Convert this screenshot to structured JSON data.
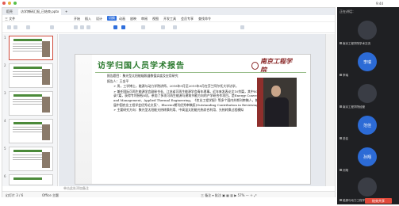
{
  "system_bar": {
    "left": "◉ ◉ ◉",
    "time": "9:44",
    "icons": "▢ ▣ ✕"
  },
  "tabs": [
    "稻壳",
    "访学博研汇报_已结束.pptx",
    "+"
  ],
  "menu": [
    "三 文件",
    "开始",
    "插入",
    "设计",
    "切换",
    "动画",
    "放映",
    "审阅",
    "视图",
    "开发工具",
    "会员专享",
    "查找命令"
  ],
  "menu_active_index": 4,
  "slide_numbers": [
    "1",
    "2",
    "3",
    "4",
    "5",
    "6"
  ],
  "slide": {
    "title": "访学归国人员学术报告",
    "logo": "南京工程学院",
    "report_title": "报告题目：聚光型太阳能辐照器数值实度及应用研究",
    "reporter": "报告人：王金平",
    "bullets": [
      "男，工学博士，能源与动力学院讲师。2018年9月至2019年8月在芬兰阿尔托大学访学。",
      "兼任国际可再生能源学会副秘书长、江苏省可再生能源学会青年理事。近年来发表论文10余篇，其中SCI/EI收录7篇，获得专利授权6项，参加了多项可再生能源与建筑节能方向的产学研合作项目。是Energy Conversion and Management、Applied Thermal Engineering、《农业工程学报》等多个国内外期刊审稿人，曾获“第二届中国农业工程学会优秀论文奖”、Elsevier期刊优秀审稿奖(Outstanding Contribution in Reviewing)。",
      "主要研究方向：聚光型太阳能光热转换利用、中高温太阳能光热综合利用、光热转换过程模拟"
    ]
  },
  "notes_placeholder": "单击此处添加备注",
  "status": {
    "left": "幻灯片 3 / 6",
    "theme": "Office 主题",
    "right": "三 备注 ▾   批注   ▣ ▦ ▥ ▶   57%  —   ＋  ⤢"
  },
  "side": {
    "header": "正在讲话：",
    "participants": [
      {
        "avatar": "",
        "name": "南京工程学院学术交流",
        "color": "#3a3d45"
      },
      {
        "avatar": "李瑞",
        "name": "李瑞",
        "color": "#2c6bd6"
      },
      {
        "avatar": "",
        "name": "南京工程学院经管",
        "color": "#3a3d45"
      },
      {
        "avatar": "范佳",
        "name": "范佳",
        "color": "#2c6bd6"
      },
      {
        "avatar": "孙翔",
        "name": "孙翔",
        "color": "#2c6bd6"
      },
      {
        "avatar": "",
        "name": "能源与动力工程学院",
        "color": "#3a3d45"
      }
    ]
  },
  "end_button": "结束共享"
}
